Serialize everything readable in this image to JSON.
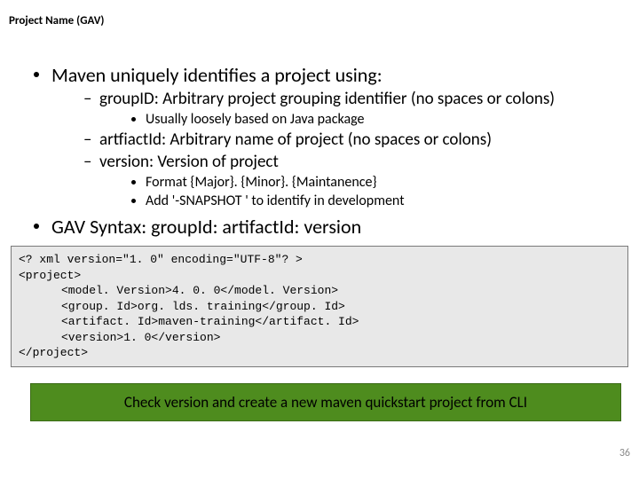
{
  "title": "Project Name (GAV)",
  "bullets": {
    "b1": "Maven uniquely identifies a project using:",
    "b1a": "groupID: Arbitrary project grouping identifier (no spaces or colons)",
    "b1a1": "Usually loosely based on Java package",
    "b1b": "artfiactId: Arbitrary name of project (no spaces or colons)",
    "b1c": "version: Version of project",
    "b1c1": "Format {Major}. {Minor}. {Maintanence}",
    "b1c2": "Add '-SNAPSHOT ' to identify in development",
    "b2": "GAV Syntax: groupId: artifactId: version"
  },
  "code": {
    "l1": "<? xml version=\"1. 0\" encoding=\"UTF-8\"? >",
    "l2": "<project>",
    "l3": "<model. Version>4. 0. 0</model. Version>",
    "l4": "<group. Id>org. lds. training</group. Id>",
    "l5": "<artifact. Id>maven-training</artifact. Id>",
    "l6": "<version>1. 0</version>",
    "l7": "</project>"
  },
  "banner": "Check version and create a new maven quickstart project from CLI",
  "page": "36"
}
